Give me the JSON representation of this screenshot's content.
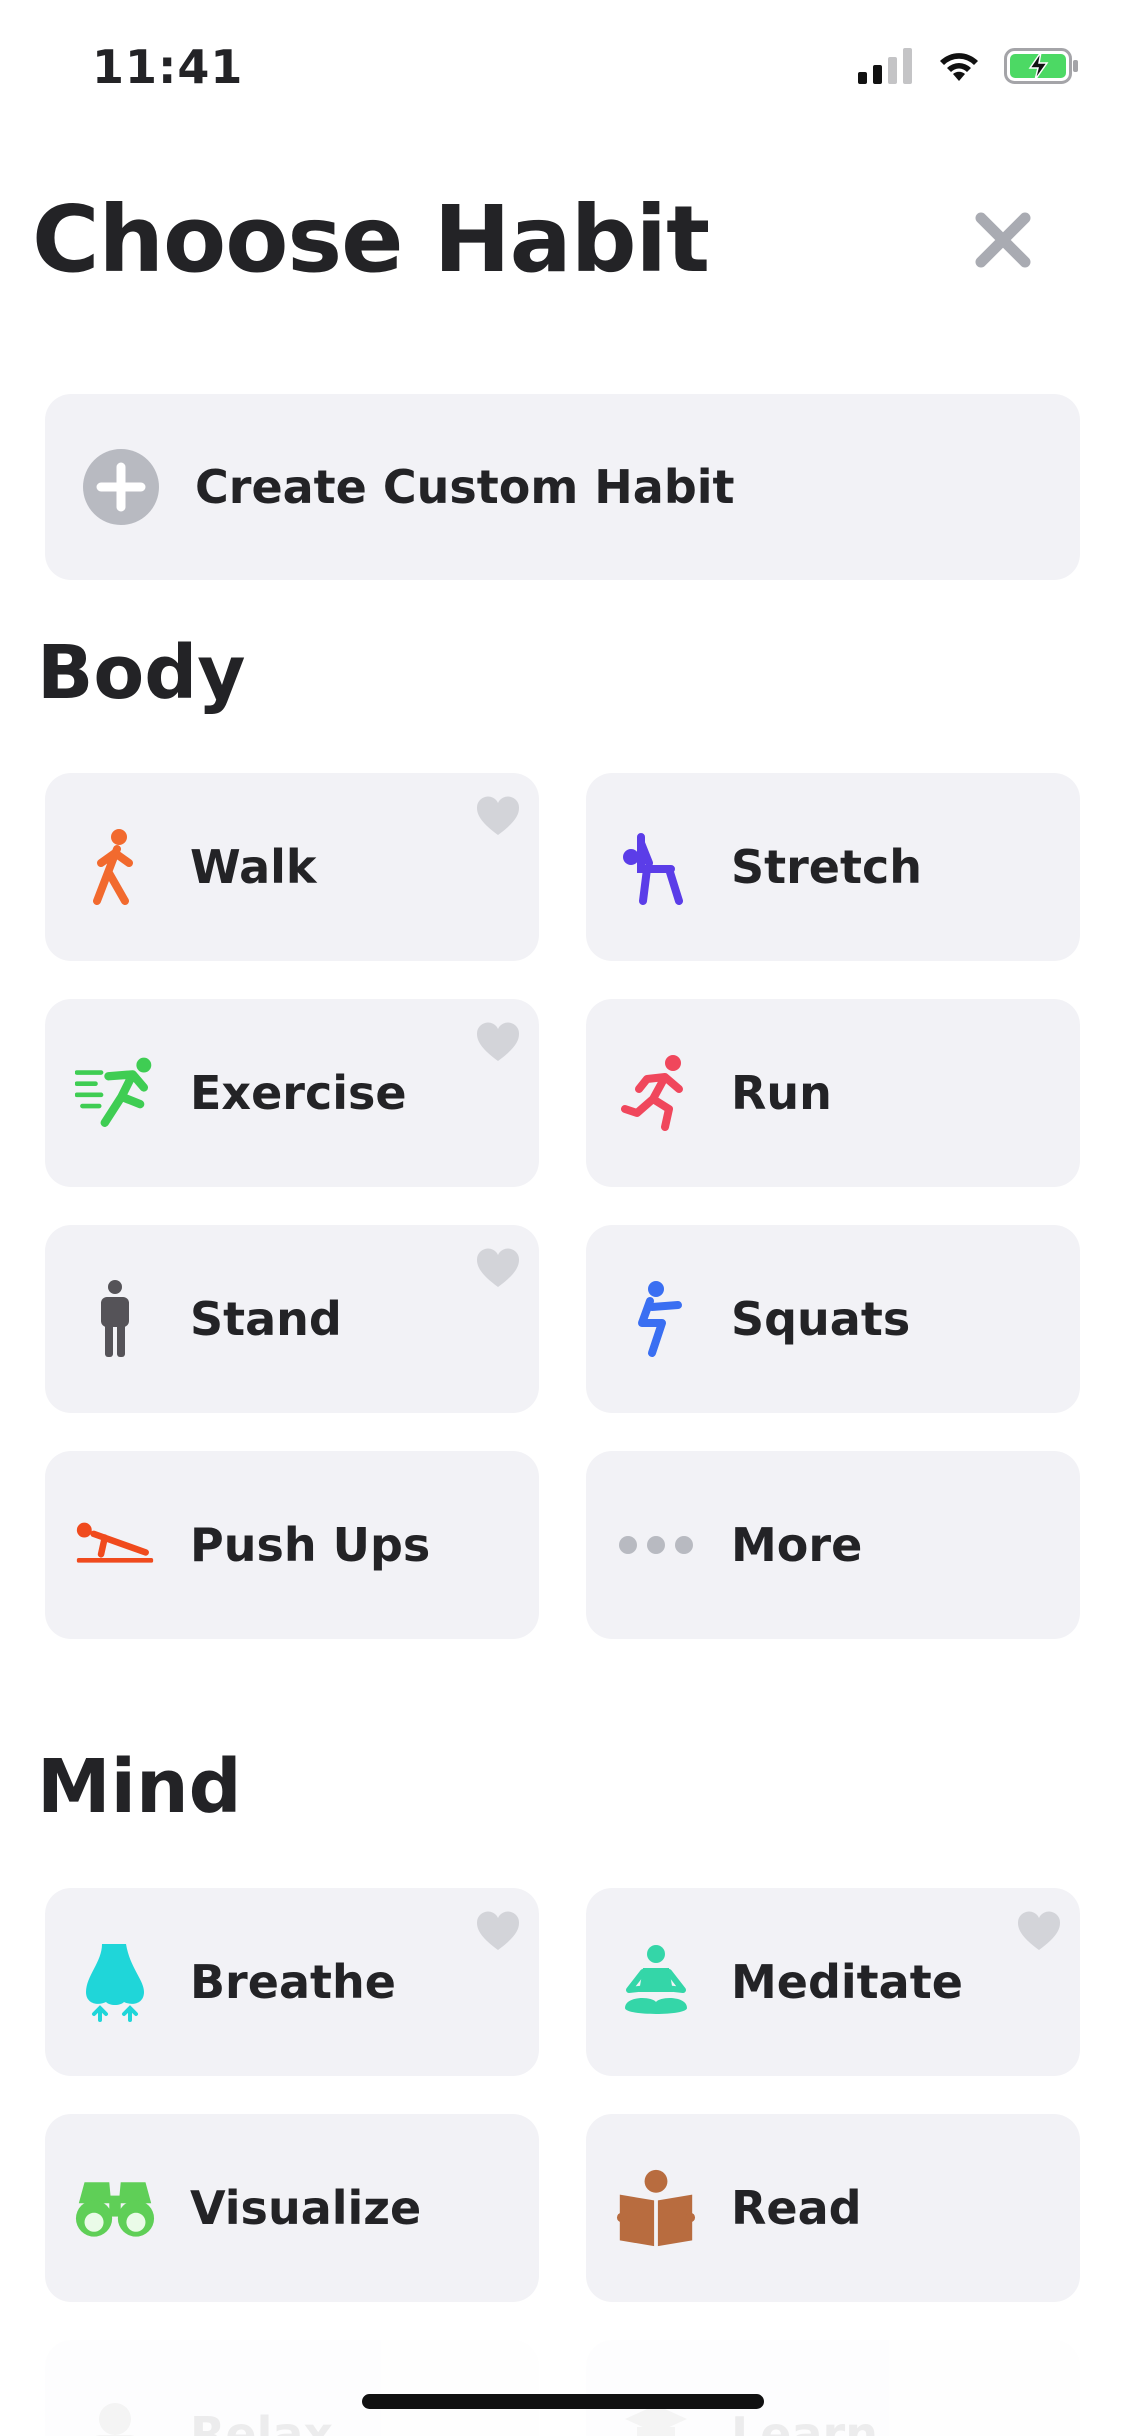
{
  "status_bar": {
    "time": "11:41"
  },
  "header": {
    "title": "Choose Habit"
  },
  "custom_habit": {
    "label": "Create Custom Habit"
  },
  "sections": {
    "body": {
      "title": "Body",
      "items": [
        {
          "label": "Walk",
          "icon": "walk-icon",
          "color": "#f26a2e",
          "heart": true
        },
        {
          "label": "Stretch",
          "icon": "stretch-icon",
          "color": "#5b3de8",
          "heart": false
        },
        {
          "label": "Exercise",
          "icon": "exercise-icon",
          "color": "#3fcd53",
          "heart": true
        },
        {
          "label": "Run",
          "icon": "run-icon",
          "color": "#f0475c",
          "heart": false
        },
        {
          "label": "Stand",
          "icon": "stand-icon",
          "color": "#555358",
          "heart": true
        },
        {
          "label": "Squats",
          "icon": "squats-icon",
          "color": "#3a6ff2",
          "heart": false
        },
        {
          "label": "Push Ups",
          "icon": "push-ups-icon",
          "color": "#f04a1d",
          "heart": false
        },
        {
          "label": "More",
          "icon": "more-icon",
          "color": "#b8bac1",
          "heart": false
        }
      ]
    },
    "mind": {
      "title": "Mind",
      "items": [
        {
          "label": "Breathe",
          "icon": "nose-icon",
          "color": "#1fd6d9",
          "heart": true
        },
        {
          "label": "Meditate",
          "icon": "meditate-icon",
          "color": "#34d6a8",
          "heart": true
        },
        {
          "label": "Visualize",
          "icon": "binoculars-icon",
          "color": "#5fcf57",
          "heart": false
        },
        {
          "label": "Read",
          "icon": "book-icon",
          "color": "#b86c3f",
          "heart": false
        },
        {
          "label": "Relax",
          "icon": "relax-icon",
          "color": "#7a7a7a",
          "heart": false
        },
        {
          "label": "Learn",
          "icon": "learn-icon",
          "color": "#7a7a7a",
          "heart": false
        }
      ]
    }
  }
}
